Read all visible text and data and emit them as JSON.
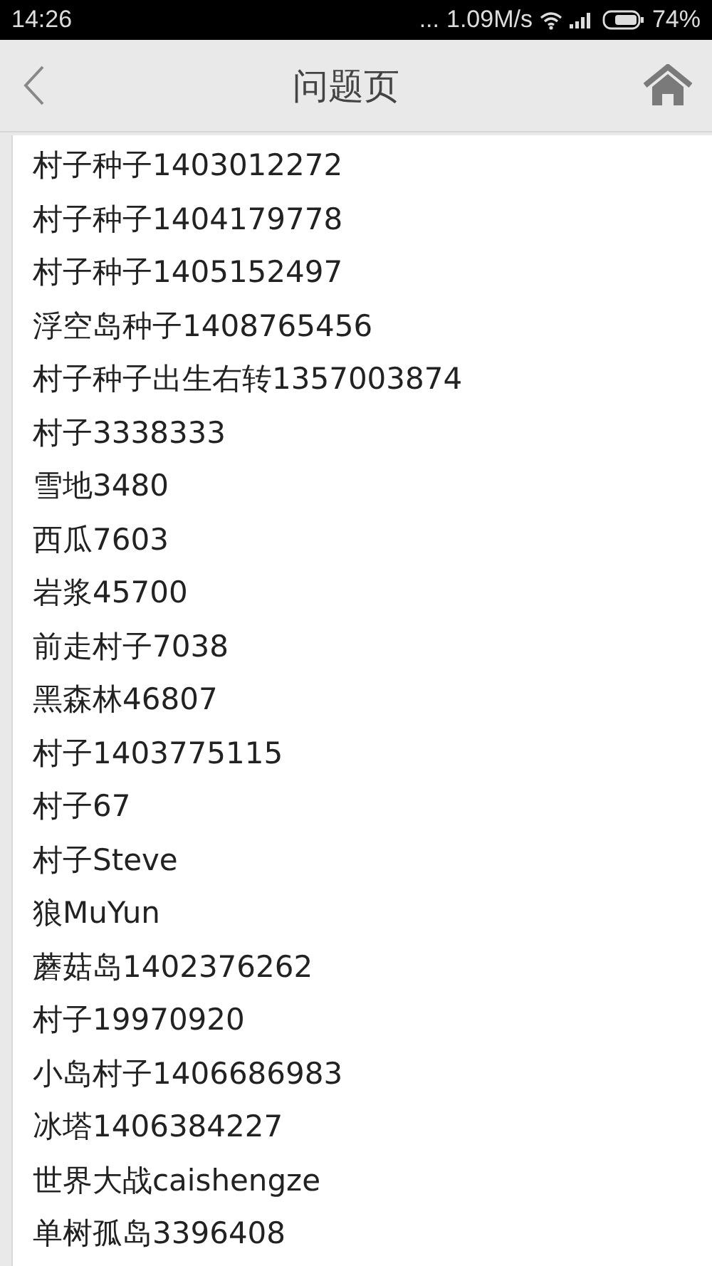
{
  "status_bar": {
    "time": "14:26",
    "dots": "...",
    "speed": "1.09M/s",
    "battery": "74%"
  },
  "header": {
    "title": "问题页"
  },
  "items": [
    "村子种子1403012272",
    "村子种子1404179778",
    "村子种子1405152497",
    "浮空岛种子1408765456",
    "村子种子出生右转1357003874",
    "村子3338333",
    "雪地3480",
    "西瓜7603",
    "岩浆45700",
    "前走村子7038",
    "黑森林46807",
    "村子1403775115",
    "村子67",
    "村子Steve",
    "狼MuYun",
    "蘑菇岛1402376262",
    "村子19970920",
    "小岛村子1406686983",
    "冰塔1406384227",
    "世界大战caishengze",
    "单树孤岛3396408"
  ]
}
